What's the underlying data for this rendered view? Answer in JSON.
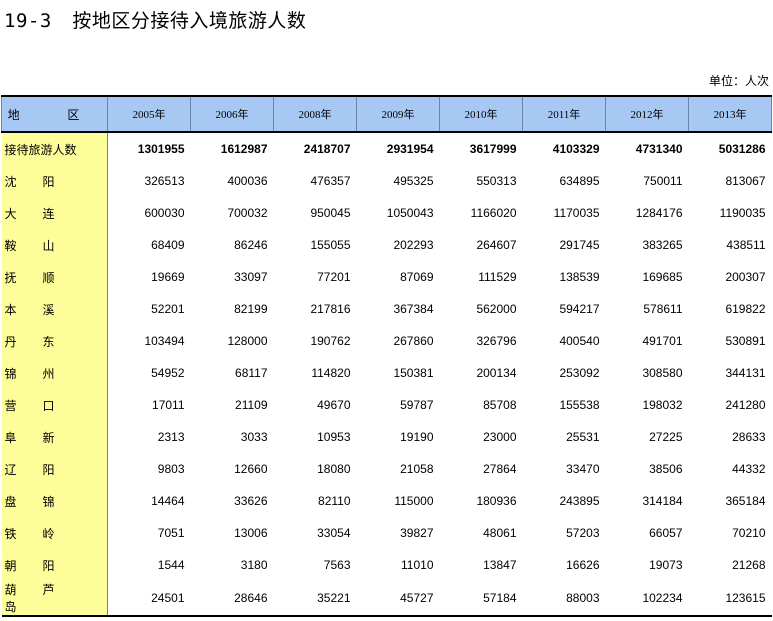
{
  "page": {
    "table_no": "19-3",
    "title": "按地区分接待入境旅游人数",
    "unit": "单位：人次"
  },
  "table": {
    "region_header": "地 区",
    "years": [
      "2005年",
      "2006年",
      "2008年",
      "2009年",
      "2010年",
      "2011年",
      "2012年",
      "2013年"
    ],
    "total": {
      "label": "接待旅游人数",
      "values": [
        "1301955",
        "1612987",
        "2418707",
        "2931954",
        "3617999",
        "4103329",
        "4731340",
        "5031286"
      ]
    },
    "rows": [
      {
        "region": "沈阳",
        "values": [
          "326513",
          "400036",
          "476357",
          "495325",
          "550313",
          "634895",
          "750011",
          "813067"
        ]
      },
      {
        "region": "大连",
        "values": [
          "600030",
          "700032",
          "950045",
          "1050043",
          "1166020",
          "1170035",
          "1284176",
          "1190035"
        ]
      },
      {
        "region": "鞍山",
        "values": [
          "68409",
          "86246",
          "155055",
          "202293",
          "264607",
          "291745",
          "383265",
          "438511"
        ]
      },
      {
        "region": "抚顺",
        "values": [
          "19669",
          "33097",
          "77201",
          "87069",
          "111529",
          "138539",
          "169685",
          "200307"
        ]
      },
      {
        "region": "本溪",
        "values": [
          "52201",
          "82199",
          "217816",
          "367384",
          "562000",
          "594217",
          "578611",
          "619822"
        ]
      },
      {
        "region": "丹东",
        "values": [
          "103494",
          "128000",
          "190762",
          "267860",
          "326796",
          "400540",
          "491701",
          "530891"
        ]
      },
      {
        "region": "锦州",
        "values": [
          "54952",
          "68117",
          "114820",
          "150381",
          "200134",
          "253092",
          "308580",
          "344131"
        ]
      },
      {
        "region": "营口",
        "values": [
          "17011",
          "21109",
          "49670",
          "59787",
          "85708",
          "155538",
          "198032",
          "241280"
        ]
      },
      {
        "region": "阜新",
        "values": [
          "2313",
          "3033",
          "10953",
          "19190",
          "23000",
          "25531",
          "27225",
          "28633"
        ]
      },
      {
        "region": "辽阳",
        "values": [
          "9803",
          "12660",
          "18080",
          "21058",
          "27864",
          "33470",
          "38506",
          "44332"
        ]
      },
      {
        "region": "盘锦",
        "values": [
          "14464",
          "33626",
          "82110",
          "115000",
          "180936",
          "243895",
          "314184",
          "365184"
        ]
      },
      {
        "region": "铁岭",
        "values": [
          "7051",
          "13006",
          "33054",
          "39827",
          "48061",
          "57203",
          "66057",
          "70210"
        ]
      },
      {
        "region": "朝阳",
        "values": [
          "1544",
          "3180",
          "7563",
          "11010",
          "13847",
          "16626",
          "19073",
          "21268"
        ]
      },
      {
        "region": "葫芦岛",
        "values": [
          "24501",
          "28646",
          "35221",
          "45727",
          "57184",
          "88003",
          "102234",
          "123615"
        ]
      }
    ]
  }
}
